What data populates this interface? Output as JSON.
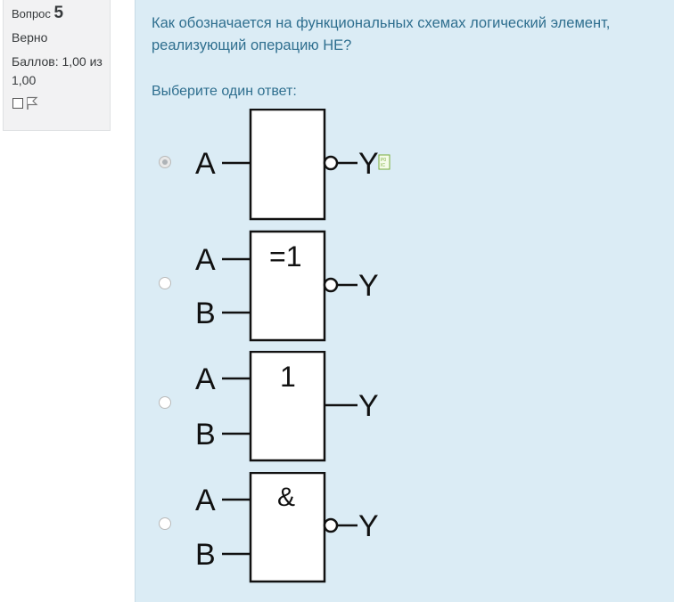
{
  "question_info": {
    "label": "Вопрос",
    "number": "5",
    "state": "Верно",
    "grade": "Баллов: 1,00 из 1,00"
  },
  "question": {
    "text": "Как обозначается на функциональных схемах логический элемент, реализующий операцию НЕ?",
    "prompt": "Выберите один ответ:"
  },
  "options": [
    {
      "inputs": [
        "A"
      ],
      "symbol": "",
      "output": "Y",
      "inverted": true,
      "selected": true
    },
    {
      "inputs": [
        "A",
        "B"
      ],
      "symbol": "=1",
      "output": "Y",
      "inverted": true,
      "selected": false
    },
    {
      "inputs": [
        "A",
        "B"
      ],
      "symbol": "1",
      "output": "Y",
      "inverted": false,
      "selected": false
    },
    {
      "inputs": [
        "A",
        "B"
      ],
      "symbol": "&",
      "output": "Y",
      "inverted": true,
      "selected": false
    }
  ],
  "icons": {
    "flag": "flag-icon",
    "feedback": "correct-feedback-icon"
  }
}
